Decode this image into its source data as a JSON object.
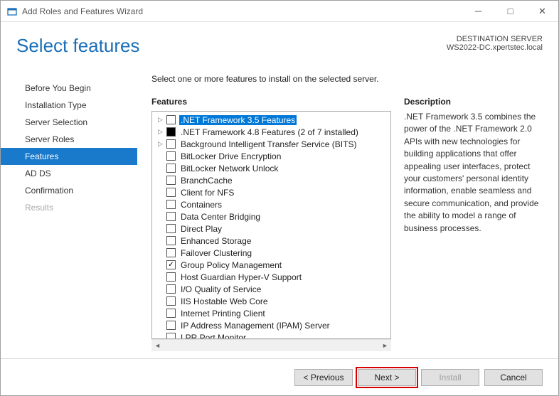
{
  "window": {
    "title": "Add Roles and Features Wizard"
  },
  "header": {
    "title": "Select features",
    "dest_label": "DESTINATION SERVER",
    "dest_name": "WS2022-DC.xpertstec.local"
  },
  "sidebar": {
    "items": [
      {
        "label": "Before You Begin",
        "state": "normal"
      },
      {
        "label": "Installation Type",
        "state": "normal"
      },
      {
        "label": "Server Selection",
        "state": "normal"
      },
      {
        "label": "Server Roles",
        "state": "normal"
      },
      {
        "label": "Features",
        "state": "selected"
      },
      {
        "label": "AD DS",
        "state": "normal"
      },
      {
        "label": "Confirmation",
        "state": "normal"
      },
      {
        "label": "Results",
        "state": "disabled"
      }
    ]
  },
  "main": {
    "instruction": "Select one or more features to install on the selected server.",
    "features_heading": "Features",
    "desc_heading": "Description",
    "description": ".NET Framework 3.5 combines the power of the .NET Framework 2.0 APIs with new technologies for building applications that offer appealing user interfaces, protect your customers' personal identity information, enable seamless and secure communication, and provide the ability to model a range of business processes.",
    "features": [
      {
        "label": ".NET Framework 3.5 Features",
        "expandable": true,
        "checked": false,
        "highlighted": true
      },
      {
        "label": ".NET Framework 4.8 Features (2 of 7 installed)",
        "expandable": true,
        "checked": "partial"
      },
      {
        "label": "Background Intelligent Transfer Service (BITS)",
        "expandable": true,
        "checked": false
      },
      {
        "label": "BitLocker Drive Encryption",
        "expandable": false,
        "checked": false
      },
      {
        "label": "BitLocker Network Unlock",
        "expandable": false,
        "checked": false
      },
      {
        "label": "BranchCache",
        "expandable": false,
        "checked": false
      },
      {
        "label": "Client for NFS",
        "expandable": false,
        "checked": false
      },
      {
        "label": "Containers",
        "expandable": false,
        "checked": false
      },
      {
        "label": "Data Center Bridging",
        "expandable": false,
        "checked": false
      },
      {
        "label": "Direct Play",
        "expandable": false,
        "checked": false
      },
      {
        "label": "Enhanced Storage",
        "expandable": false,
        "checked": false
      },
      {
        "label": "Failover Clustering",
        "expandable": false,
        "checked": false
      },
      {
        "label": "Group Policy Management",
        "expandable": false,
        "checked": true
      },
      {
        "label": "Host Guardian Hyper-V Support",
        "expandable": false,
        "checked": false
      },
      {
        "label": "I/O Quality of Service",
        "expandable": false,
        "checked": false
      },
      {
        "label": "IIS Hostable Web Core",
        "expandable": false,
        "checked": false
      },
      {
        "label": "Internet Printing Client",
        "expandable": false,
        "checked": false
      },
      {
        "label": "IP Address Management (IPAM) Server",
        "expandable": false,
        "checked": false
      },
      {
        "label": "LPR Port Monitor",
        "expandable": false,
        "checked": false
      }
    ]
  },
  "footer": {
    "previous": "< Previous",
    "next": "Next >",
    "install": "Install",
    "cancel": "Cancel"
  }
}
